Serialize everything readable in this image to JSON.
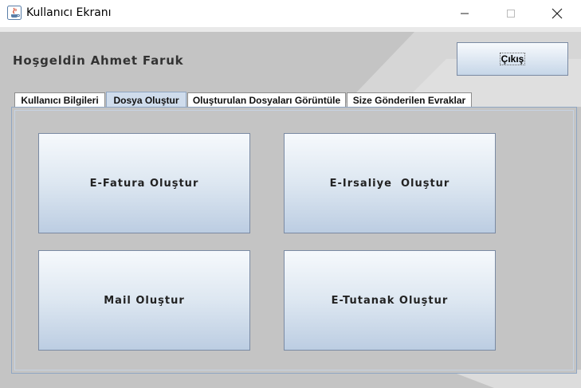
{
  "window": {
    "title": "Kullanıcı Ekranı"
  },
  "header": {
    "welcome_text": "Hoşgeldin Ahmet Faruk",
    "exit_label": "Çıkış"
  },
  "tabs": [
    {
      "label": "Kullanıcı Bilgileri",
      "active": false
    },
    {
      "label": "Dosya Oluştur",
      "active": true
    },
    {
      "label": "Oluşturulan Dosyaları Görüntüle",
      "active": false
    },
    {
      "label": "Size Gönderilen Evraklar",
      "active": false
    }
  ],
  "actions": {
    "efatura": "E-Fatura Oluştur",
    "eirsaliye": "E-Irsaliye  Oluştur",
    "mail": "Mail Oluştur",
    "etutanak": "E-Tutanak Oluştur"
  },
  "colors": {
    "frame_bg": "#c4c4c4",
    "button_top": "#f6f9fc",
    "button_bottom": "#bccde2",
    "active_tab": "#cfdcec"
  }
}
